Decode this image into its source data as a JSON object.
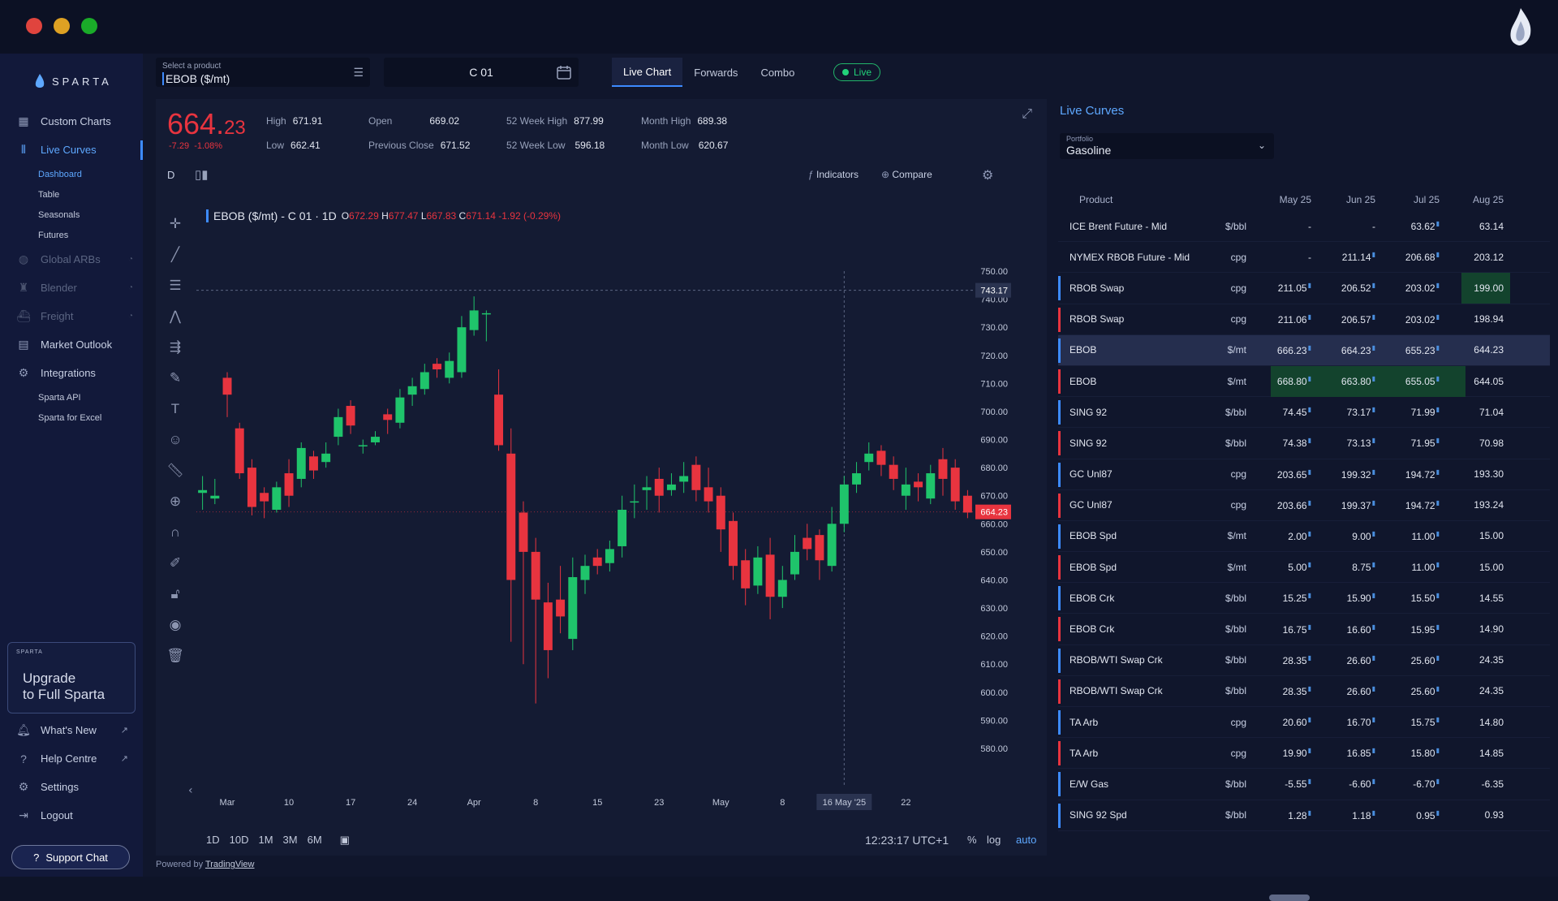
{
  "window": {
    "brand": "SPARTA"
  },
  "sidebar": {
    "items": [
      {
        "label": "Custom Charts",
        "icon": "grid-icon"
      },
      {
        "label": "Live Curves",
        "icon": "curves-icon",
        "active": true
      },
      {
        "label": "Dashboard",
        "sub": true,
        "active": true
      },
      {
        "label": "Table",
        "sub": true
      },
      {
        "label": "Seasonals",
        "sub": true
      },
      {
        "label": "Futures",
        "sub": true
      },
      {
        "label": "Global ARBs",
        "icon": "globe-icon",
        "locked": true
      },
      {
        "label": "Blender",
        "icon": "blender-icon",
        "locked": true
      },
      {
        "label": "Freight",
        "icon": "ship-icon",
        "locked": true
      },
      {
        "label": "Market Outlook",
        "icon": "document-icon"
      },
      {
        "label": "Integrations",
        "icon": "integrations-icon"
      },
      {
        "label": "Sparta API",
        "sub": true
      },
      {
        "label": "Sparta for Excel",
        "sub": true
      }
    ],
    "upgrade": {
      "small": "SPARTA",
      "line1": "Upgrade",
      "line2": "to Full Sparta"
    },
    "bottom": [
      {
        "label": "What's New",
        "icon": "bell-icon"
      },
      {
        "label": "Help Centre",
        "icon": "help-icon"
      },
      {
        "label": "Settings",
        "icon": "gear-icon"
      },
      {
        "label": "Logout",
        "icon": "logout-icon"
      }
    ],
    "support": "Support Chat"
  },
  "header": {
    "product_label": "Select a product",
    "product_value": "EBOB ($/mt)",
    "contract_value": "C 01",
    "tabs": [
      "Live Chart",
      "Forwards",
      "Combo"
    ],
    "live": "Live"
  },
  "quote": {
    "price_int": "664.",
    "price_dec": "23",
    "change": "-7.29",
    "change_pct": "-1.08%",
    "stats": [
      {
        "k": "High",
        "v": "671.91"
      },
      {
        "k": "Low",
        "v": "662.41"
      },
      {
        "k": "Open",
        "v": "669.02"
      },
      {
        "k": "Previous Close",
        "v": "671.52"
      },
      {
        "k": "52 Week High",
        "v": "877.99"
      },
      {
        "k": "52 Week Low",
        "v": "596.18"
      },
      {
        "k": "Month High",
        "v": "689.38"
      },
      {
        "k": "Month Low",
        "v": "620.67"
      }
    ]
  },
  "chart_toolbar": {
    "interval": "D",
    "indicators": "Indicators",
    "compare": "Compare"
  },
  "chart_legend": {
    "symbol": "EBOB ($/mt) - C 01 · 1D",
    "o": "672.29",
    "h": "677.47",
    "l": "667.83",
    "c": "671.14",
    "chg": "-1.92 (-0.29%)"
  },
  "timeframes": [
    "1D",
    "10D",
    "1M",
    "3M",
    "6M"
  ],
  "time_readout": "12:23:17 UTC+1",
  "options": {
    "pct": "%",
    "log": "log",
    "auto": "auto"
  },
  "powered": {
    "prefix": "Powered by ",
    "link": "TradingView"
  },
  "chart_data": {
    "type": "candlestick",
    "ylim": [
      580,
      750
    ],
    "y_ticks": [
      "750.00",
      "740.00",
      "730.00",
      "720.00",
      "710.00",
      "700.00",
      "690.00",
      "680.00",
      "670.00",
      "660.00",
      "650.00",
      "640.00",
      "630.00",
      "620.00",
      "610.00",
      "600.00",
      "590.00",
      "580.00"
    ],
    "x_ticks": [
      "Mar",
      "10",
      "17",
      "24",
      "Apr",
      "8",
      "15",
      "23",
      "May",
      "8",
      "16 May '25",
      "22"
    ],
    "crosshair_price": "743.17",
    "last_price": "664.23",
    "candles": [
      [
        671,
        672,
        677,
        665
      ],
      [
        669,
        670,
        676,
        667
      ],
      [
        712,
        706,
        714,
        698
      ],
      [
        694,
        678,
        696,
        676
      ],
      [
        680,
        666,
        683,
        663
      ],
      [
        671,
        668,
        673,
        662
      ],
      [
        665,
        673,
        675,
        664
      ],
      [
        678,
        670,
        683,
        666
      ],
      [
        676,
        687,
        689,
        673
      ],
      [
        684,
        679,
        686,
        676
      ],
      [
        682,
        685,
        689,
        680
      ],
      [
        691,
        698,
        701,
        688
      ],
      [
        702,
        695,
        704,
        692
      ],
      [
        688,
        688,
        690,
        685
      ],
      [
        689,
        691,
        693,
        688
      ],
      [
        699,
        697,
        701,
        692
      ],
      [
        696,
        705,
        708,
        694
      ],
      [
        706,
        709,
        712,
        702
      ],
      [
        708,
        714,
        717,
        706
      ],
      [
        717,
        715,
        719,
        712
      ],
      [
        712,
        718,
        721,
        710
      ],
      [
        714,
        730,
        734,
        712
      ],
      [
        729,
        736,
        741,
        727
      ],
      [
        735,
        735,
        736,
        725
      ],
      [
        706,
        688,
        715,
        686
      ],
      [
        685,
        640,
        694,
        618
      ],
      [
        664,
        650,
        668,
        610
      ],
      [
        650,
        633,
        655,
        596
      ],
      [
        632,
        615,
        639,
        605
      ],
      [
        633,
        627,
        645,
        621
      ],
      [
        619,
        641,
        648,
        615
      ],
      [
        640,
        645,
        649,
        635
      ],
      [
        648,
        645,
        651,
        642
      ],
      [
        646,
        651,
        654,
        643
      ],
      [
        652,
        665,
        670,
        648
      ],
      [
        668,
        668,
        674,
        662
      ],
      [
        672,
        673,
        677,
        665
      ],
      [
        676,
        670,
        680,
        664
      ],
      [
        672,
        674,
        678,
        670
      ],
      [
        675,
        677,
        682,
        671
      ],
      [
        681,
        672,
        684,
        668
      ],
      [
        673,
        668,
        680,
        664
      ],
      [
        670,
        658,
        673,
        650
      ],
      [
        661,
        645,
        664,
        640
      ],
      [
        647,
        637,
        651,
        631
      ],
      [
        638,
        648,
        652,
        635
      ],
      [
        649,
        634,
        655,
        626
      ],
      [
        634,
        640,
        645,
        630
      ],
      [
        642,
        650,
        656,
        640
      ],
      [
        655,
        651,
        660,
        647
      ],
      [
        656,
        647,
        658,
        640
      ],
      [
        645,
        660,
        666,
        643
      ],
      [
        660,
        674,
        677,
        657
      ],
      [
        674,
        678,
        682,
        671
      ],
      [
        682,
        685,
        689,
        679
      ],
      [
        686,
        681,
        688,
        677
      ],
      [
        681,
        676,
        684,
        672
      ],
      [
        670,
        674,
        680,
        665
      ],
      [
        675,
        673,
        678,
        668
      ],
      [
        669,
        678,
        681,
        667
      ],
      [
        683,
        676,
        687,
        670
      ],
      [
        680,
        668,
        683,
        665
      ],
      [
        670,
        664,
        672,
        662
      ]
    ],
    "candle_fields": [
      "open",
      "close",
      "high",
      "low"
    ]
  },
  "curves": {
    "title": "Live Curves",
    "portfolio_label": "Portfolio",
    "portfolio_value": "Gasoline",
    "columns": [
      "Product",
      "",
      "May 25",
      "Jun 25",
      "Jul 25",
      "Aug 25"
    ],
    "rows": [
      {
        "p": "ICE Brent Future - Mid",
        "u": "$/bbl",
        "v": [
          "-",
          "-",
          "63.62",
          "63.14"
        ],
        "bar": ""
      },
      {
        "p": "NYMEX RBOB Future - Mid",
        "u": "cpg",
        "v": [
          "-",
          "211.14",
          "206.68",
          "203.12"
        ],
        "bar": ""
      },
      {
        "p": "RBOB Swap",
        "u": "cpg",
        "v": [
          "211.05",
          "206.52",
          "203.02",
          "199.00"
        ],
        "bar": "#3d8bff"
      },
      {
        "p": "RBOB Swap",
        "u": "cpg",
        "v": [
          "211.06",
          "206.57",
          "203.02",
          "198.94"
        ],
        "bar": "#e8343f"
      },
      {
        "p": "EBOB",
        "u": "$/mt",
        "v": [
          "666.23",
          "664.23",
          "655.23",
          "644.23"
        ],
        "bar": "#3d8bff"
      },
      {
        "p": "EBOB",
        "u": "$/mt",
        "v": [
          "668.80",
          "663.80",
          "655.05",
          "644.05"
        ],
        "bar": "#e8343f"
      },
      {
        "p": "SING 92",
        "u": "$/bbl",
        "v": [
          "74.45",
          "73.17",
          "71.99",
          "71.04"
        ],
        "bar": "#3d8bff"
      },
      {
        "p": "SING 92",
        "u": "$/bbl",
        "v": [
          "74.38",
          "73.13",
          "71.95",
          "70.98"
        ],
        "bar": "#e8343f"
      },
      {
        "p": "GC Unl87",
        "u": "cpg",
        "v": [
          "203.65",
          "199.32",
          "194.72",
          "193.30"
        ],
        "bar": "#3d8bff"
      },
      {
        "p": "GC Unl87",
        "u": "cpg",
        "v": [
          "203.66",
          "199.37",
          "194.72",
          "193.24"
        ],
        "bar": "#e8343f"
      },
      {
        "p": "EBOB Spd",
        "u": "$/mt",
        "v": [
          "2.00",
          "9.00",
          "11.00",
          "15.00"
        ],
        "bar": "#3d8bff"
      },
      {
        "p": "EBOB Spd",
        "u": "$/mt",
        "v": [
          "5.00",
          "8.75",
          "11.00",
          "15.00"
        ],
        "bar": "#e8343f"
      },
      {
        "p": "EBOB Crk",
        "u": "$/bbl",
        "v": [
          "15.25",
          "15.90",
          "15.50",
          "14.55"
        ],
        "bar": "#3d8bff"
      },
      {
        "p": "EBOB Crk",
        "u": "$/bbl",
        "v": [
          "16.75",
          "16.60",
          "15.95",
          "14.90"
        ],
        "bar": "#e8343f"
      },
      {
        "p": "RBOB/WTI Swap Crk",
        "u": "$/bbl",
        "v": [
          "28.35",
          "26.60",
          "25.60",
          "24.35"
        ],
        "bar": "#3d8bff"
      },
      {
        "p": "RBOB/WTI Swap Crk",
        "u": "$/bbl",
        "v": [
          "28.35",
          "26.60",
          "25.60",
          "24.35"
        ],
        "bar": "#e8343f"
      },
      {
        "p": "TA Arb",
        "u": "cpg",
        "v": [
          "20.60",
          "16.70",
          "15.75",
          "14.80"
        ],
        "bar": "#3d8bff"
      },
      {
        "p": "TA Arb",
        "u": "cpg",
        "v": [
          "19.90",
          "16.85",
          "15.80",
          "14.85"
        ],
        "bar": "#e8343f"
      },
      {
        "p": "E/W Gas",
        "u": "$/bbl",
        "v": [
          "-5.55",
          "-6.60",
          "-6.70",
          "-6.35"
        ],
        "bar": "#3d8bff"
      },
      {
        "p": "SING 92 Spd",
        "u": "$/bbl",
        "v": [
          "1.28",
          "1.18",
          "0.95",
          "0.93"
        ],
        "bar": "#3d8bff"
      }
    ]
  },
  "colors": {
    "up": "#1fc46b",
    "down": "#e8343f",
    "accent": "#3d8bff"
  }
}
